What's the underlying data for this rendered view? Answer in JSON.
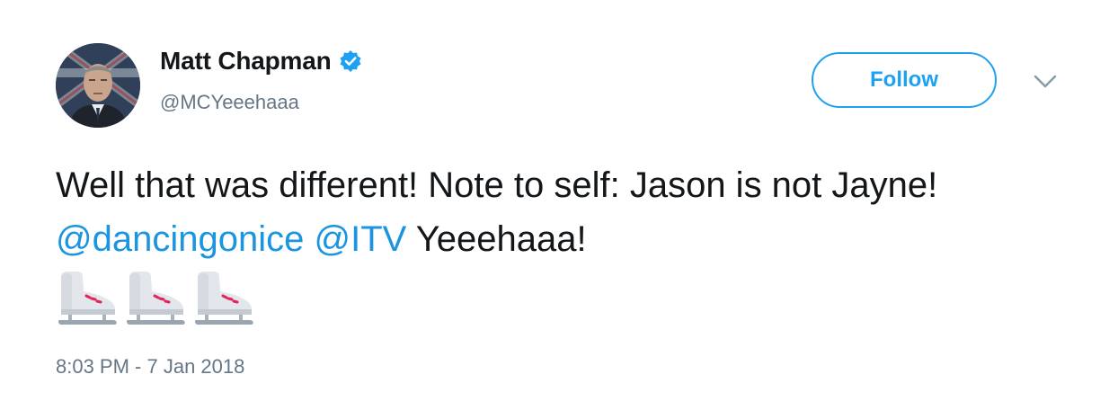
{
  "author": {
    "display_name": "Matt Chapman",
    "handle": "@MCYeeehaaa",
    "verified": true
  },
  "actions": {
    "follow_label": "Follow",
    "more_icon": "chevron-down-icon"
  },
  "tweet": {
    "text_part_1": "Well that was different! Note to self: Jason is not Jayne! ",
    "mention_1": "@dancingonice",
    "text_part_2": " ",
    "mention_2": "@ITV",
    "text_part_3": " Yeeehaaa!",
    "emoji": [
      "ice-skate",
      "ice-skate",
      "ice-skate"
    ]
  },
  "timestamp": "8:03 PM - 7 Jan 2018",
  "colors": {
    "accent": "#1da1f2",
    "mention": "#1b95e0",
    "secondary_text": "#657786",
    "primary_text": "#14171a"
  }
}
